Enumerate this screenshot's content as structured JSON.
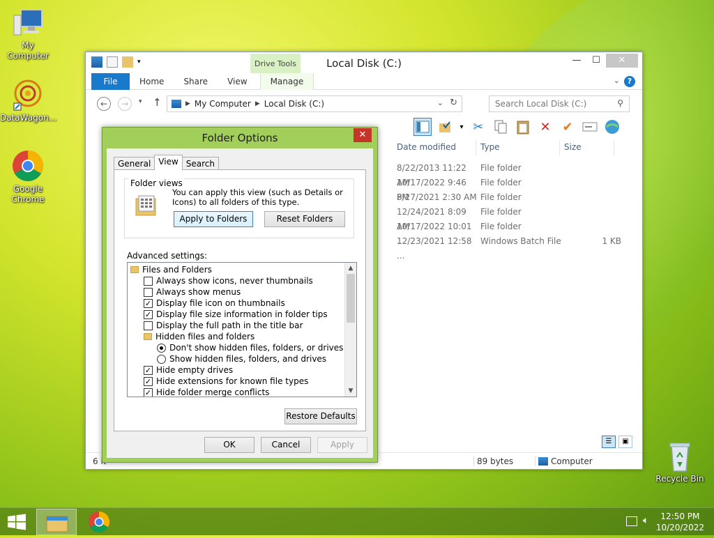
{
  "desktop": {
    "icons": [
      {
        "label": "My Computer"
      },
      {
        "label": "DataWagon..."
      },
      {
        "label": "Google Chrome"
      },
      {
        "label": "Recycle Bin"
      }
    ]
  },
  "explorer": {
    "title": "Local Disk (C:)",
    "context_tab": "Drive Tools",
    "tabs": {
      "file": "File",
      "home": "Home",
      "share": "Share",
      "view": "View",
      "manage": "Manage"
    },
    "address": {
      "crumb1": "My Computer",
      "crumb2": "Local Disk (C:)"
    },
    "search_placeholder": "Search Local Disk (C:)",
    "columns": {
      "date": "Date modified",
      "type": "Type",
      "size": "Size"
    },
    "rows": [
      {
        "date": "8/22/2013 11:22 AM",
        "type": "File folder",
        "size": ""
      },
      {
        "date": "10/17/2022 9:46 PM",
        "type": "File folder",
        "size": ""
      },
      {
        "date": "8/27/2021 2:30 AM",
        "type": "File folder",
        "size": ""
      },
      {
        "date": "12/24/2021 8:09 AM",
        "type": "File folder",
        "size": ""
      },
      {
        "date": "10/17/2022 10:01 ...",
        "type": "File folder",
        "size": ""
      },
      {
        "date": "12/23/2021 12:58 ...",
        "type": "Windows Batch File",
        "size": "1 KB"
      }
    ],
    "status": {
      "items": "6 it",
      "selected_size": "89 bytes",
      "location": "Computer"
    }
  },
  "dialog": {
    "title": "Folder Options",
    "tabs": {
      "general": "General",
      "view": "View",
      "search": "Search"
    },
    "folder_views": {
      "label": "Folder views",
      "text": "You can apply this view (such as Details or Icons) to all folders of this type.",
      "apply": "Apply to Folders",
      "reset": "Reset Folders"
    },
    "advanced_label": "Advanced settings:",
    "tree": [
      {
        "kind": "folder",
        "text": "Files and Folders"
      },
      {
        "kind": "check",
        "checked": false,
        "text": "Always show icons, never thumbnails"
      },
      {
        "kind": "check",
        "checked": false,
        "text": "Always show menus"
      },
      {
        "kind": "check",
        "checked": true,
        "text": "Display file icon on thumbnails"
      },
      {
        "kind": "check",
        "checked": true,
        "text": "Display file size information in folder tips"
      },
      {
        "kind": "check",
        "checked": false,
        "text": "Display the full path in the title bar"
      },
      {
        "kind": "folder",
        "text": "Hidden files and folders"
      },
      {
        "kind": "radio",
        "checked": true,
        "text": "Don't show hidden files, folders, or drives"
      },
      {
        "kind": "radio",
        "checked": false,
        "text": "Show hidden files, folders, and drives"
      },
      {
        "kind": "check",
        "checked": true,
        "text": "Hide empty drives"
      },
      {
        "kind": "check",
        "checked": true,
        "text": "Hide extensions for known file types"
      },
      {
        "kind": "check",
        "checked": true,
        "text": "Hide folder merge conflicts"
      }
    ],
    "restore": "Restore Defaults",
    "ok": "OK",
    "cancel": "Cancel",
    "apply": "Apply"
  },
  "taskbar": {
    "time": "12:50 PM",
    "date": "10/20/2022"
  }
}
